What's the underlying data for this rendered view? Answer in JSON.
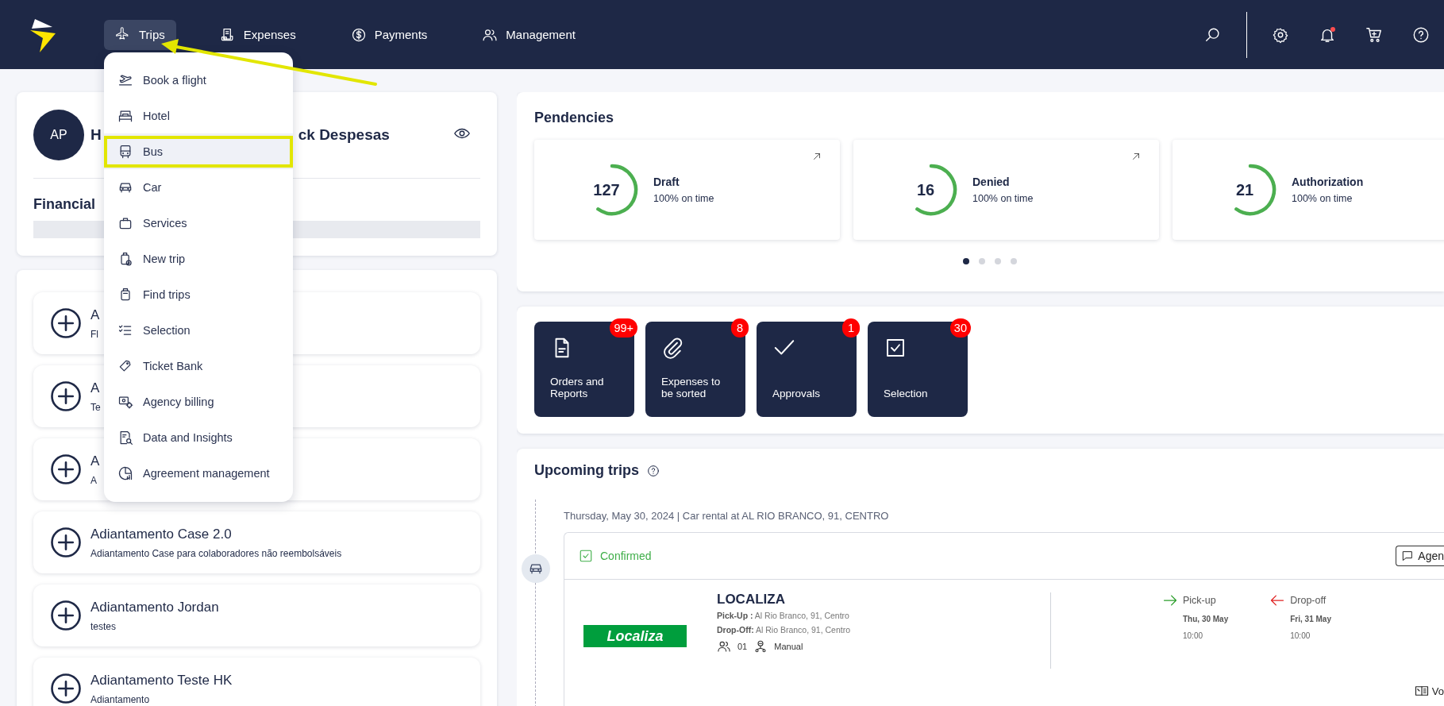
{
  "header": {
    "nav": [
      {
        "label": "Trips",
        "selected": true
      },
      {
        "label": "Expenses",
        "selected": false
      },
      {
        "label": "Payments",
        "selected": false
      },
      {
        "label": "Management",
        "selected": false
      }
    ],
    "notification_dot": true
  },
  "trips_menu": {
    "items": [
      {
        "label": "Book a flight",
        "selected": false
      },
      {
        "label": "Hotel",
        "selected": false
      },
      {
        "label": "Bus",
        "selected": true
      },
      {
        "label": "Car",
        "selected": false
      },
      {
        "label": "Services",
        "selected": false
      },
      {
        "label": "New trip",
        "selected": false
      },
      {
        "label": "Find trips",
        "selected": false
      },
      {
        "label": "Selection",
        "selected": false
      },
      {
        "label": "Ticket Bank",
        "selected": false
      },
      {
        "label": "Agency billing",
        "selected": false
      },
      {
        "label": "Data and Insights",
        "selected": false
      },
      {
        "label": "Agreement management",
        "selected": false
      }
    ]
  },
  "profile": {
    "initials": "AP",
    "name_start": "H",
    "name_end": "ck Despesas",
    "section_title": "Financial"
  },
  "advances": [
    {
      "title": "A",
      "subtitle": "Fl"
    },
    {
      "title": "A",
      "subtitle": "Te"
    },
    {
      "title": "A",
      "subtitle": "A"
    },
    {
      "title": "Adiantamento Case 2.0",
      "subtitle": "Adiantamento Case para colaboradores não reembolsáveis"
    },
    {
      "title": "Adiantamento Jordan",
      "subtitle": "testes"
    },
    {
      "title": "Adiantamento Teste HK",
      "subtitle": "Adiantamento"
    }
  ],
  "pendencies": {
    "title": "Pendencies",
    "cards": [
      {
        "count": "127",
        "label": "Draft",
        "note": "100% on time"
      },
      {
        "count": "16",
        "label": "Denied",
        "note": "100% on time"
      },
      {
        "count": "21",
        "label": "Authorization",
        "note": "100% on time"
      }
    ],
    "pages": [
      {
        "selected": true
      },
      {
        "selected": false
      },
      {
        "selected": false
      },
      {
        "selected": false
      }
    ]
  },
  "shortcuts": [
    {
      "label": "Orders and Reports",
      "badge": "99+"
    },
    {
      "label": "Expenses to be sorted",
      "badge": "8"
    },
    {
      "label": "Approvals",
      "badge": "1"
    },
    {
      "label": "Selection",
      "badge": "30"
    }
  ],
  "upcoming": {
    "title": "Upcoming trips",
    "date_line": "Thursday, May 30, 2024 | Car rental at AL RIO BRANCO, 91, CENTRO",
    "trip": {
      "status": "Confirmed",
      "agent_button": "Agen",
      "company": "LOCALIZA",
      "logo": "Localiza",
      "pickup_line": "**Pick-Up :** Al Rio Branco, 91, Centro",
      "dropoff_line": "**Drop-Off:** Al Rio Branco, 91, Centro",
      "passengers": "01",
      "transmission": "Manual",
      "pickup": {
        "title": "Pick-up",
        "date": "Thu, 30 May",
        "time": "10:00"
      },
      "dropoff": {
        "title": "Drop-off",
        "date": "Fri, 31 May",
        "time": "10:00"
      },
      "bottom_button": "Vo"
    }
  }
}
